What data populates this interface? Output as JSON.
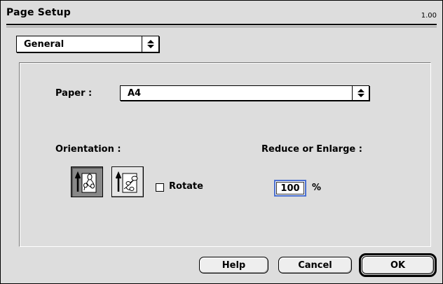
{
  "window": {
    "title": "Page Setup",
    "version": "1.00"
  },
  "panel_selector": {
    "value": "General"
  },
  "paper": {
    "label": "Paper :",
    "value": "A4"
  },
  "orientation": {
    "label": "Orientation :",
    "selected": "portrait",
    "options": [
      {
        "name": "portrait",
        "icon": "portrait-orientation-icon"
      },
      {
        "name": "landscape",
        "icon": "landscape-orientation-icon"
      }
    ]
  },
  "rotate": {
    "label": "Rotate",
    "checked": false
  },
  "scale": {
    "label": "Reduce or Enlarge :",
    "value": "100",
    "unit": "%"
  },
  "buttons": {
    "help": "Help",
    "cancel": "Cancel",
    "ok": "OK"
  },
  "colors": {
    "background": "#dddddd",
    "focus_ring": "#4a6fd0"
  }
}
